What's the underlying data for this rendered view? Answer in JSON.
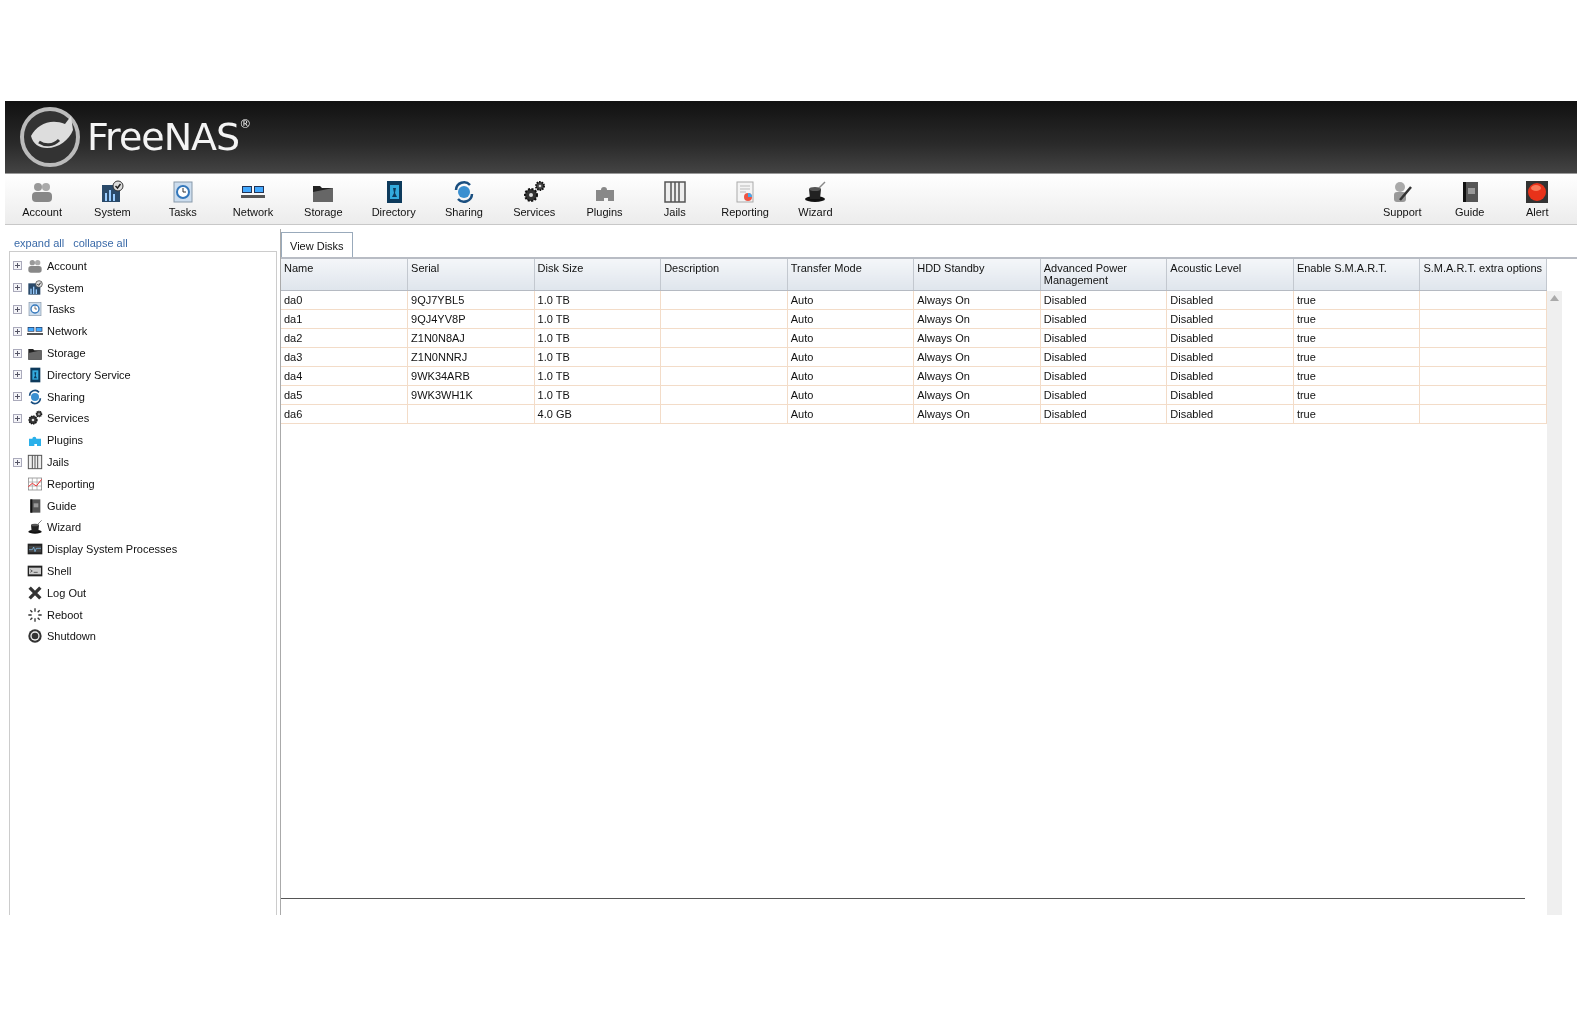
{
  "header": {
    "logo": "FreeNAS$^{®}$"
  },
  "toolbar": {
    "left": [
      "Account",
      "System",
      "Tasks",
      "Network",
      "Storage",
      "Directory",
      "Sharing",
      "Services",
      "Plugins",
      "Jails",
      "Reporting",
      "Wizard"
    ],
    "right": [
      "Support",
      "Guide",
      "Alert"
    ]
  },
  "sidebar": {
    "links": [
      "expand all",
      "collapse all"
    ],
    "items": [
      {
        "label": "Account",
        "expandable": true
      },
      {
        "label": "System",
        "expandable": true
      },
      {
        "label": "Tasks",
        "expandable": true
      },
      {
        "label": "Network",
        "expandable": true
      },
      {
        "label": "Storage",
        "expandable": true
      },
      {
        "label": "Directory Service",
        "expandable": true
      },
      {
        "label": "Sharing",
        "expandable": true
      },
      {
        "label": "Services",
        "expandable": true
      },
      {
        "label": "Plugins",
        "expandable": false
      },
      {
        "label": "Jails",
        "expandable": true
      },
      {
        "label": "Reporting",
        "expandable": false
      },
      {
        "label": "Guide",
        "expandable": false
      },
      {
        "label": "Wizard",
        "expandable": false
      },
      {
        "label": "Display System Processes",
        "expandable": false
      },
      {
        "label": "Shell",
        "expandable": false
      },
      {
        "label": "Log Out",
        "expandable": false
      },
      {
        "label": "Reboot",
        "expandable": false
      },
      {
        "label": "Shutdown",
        "expandable": false
      }
    ]
  },
  "tabs": [
    {
      "label": "View Disks",
      "selected": true
    }
  ],
  "table": {
    "columns": [
      "Name",
      "Serial",
      "Disk Size",
      "Description",
      "Transfer Mode",
      "HDD Standby",
      "Advanced Power Management",
      "Acoustic Level",
      "Enable S.M.A.R.T.",
      "S.M.A.R.T. extra options"
    ],
    "rows": [
      [
        "da0",
        "9QJ7YBL5",
        "1.0 TB",
        "",
        "Auto",
        "Always On",
        "Disabled",
        "Disabled",
        "true",
        ""
      ],
      [
        "da1",
        "9QJ4YV8P",
        "1.0 TB",
        "",
        "Auto",
        "Always On",
        "Disabled",
        "Disabled",
        "true",
        ""
      ],
      [
        "da2",
        "Z1N0N8AJ",
        "1.0 TB",
        "",
        "Auto",
        "Always On",
        "Disabled",
        "Disabled",
        "true",
        ""
      ],
      [
        "da3",
        "Z1N0NNRJ",
        "1.0 TB",
        "",
        "Auto",
        "Always On",
        "Disabled",
        "Disabled",
        "true",
        ""
      ],
      [
        "da4",
        "9WK34ARB",
        "1.0 TB",
        "",
        "Auto",
        "Always On",
        "Disabled",
        "Disabled",
        "true",
        ""
      ],
      [
        "da5",
        "9WK3WH1K",
        "1.0 TB",
        "",
        "Auto",
        "Always On",
        "Disabled",
        "Disabled",
        "true",
        ""
      ],
      [
        "da6",
        "",
        "4.0 GB",
        "",
        "Auto",
        "Always On",
        "Disabled",
        "Disabled",
        "true",
        ""
      ]
    ]
  }
}
